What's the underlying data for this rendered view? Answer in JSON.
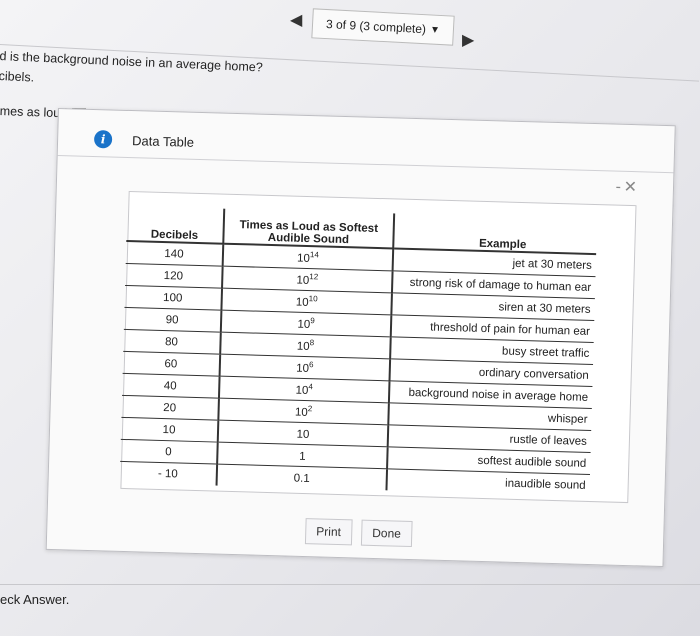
{
  "nav": {
    "prev_icon": "left-triangle-icon",
    "next_icon": "right-triangle-icon",
    "progress_label": "3 of 9 (3 complete)"
  },
  "question": {
    "line1": "d is the background noise in an average home?",
    "line2": "cibels.",
    "partial": "mes as loud as"
  },
  "check_answer": "eck Answer.",
  "modal": {
    "title": "Data Table",
    "minimize_symbol": "-",
    "close_symbol": "✕",
    "table": {
      "headers": {
        "decibels": "Decibels",
        "times_loud": "Times as Loud as Softest Audible Sound",
        "example": "Example"
      },
      "rows": [
        {
          "db": "140",
          "times_base": "10",
          "times_exp": "14",
          "example": "jet at 30 meters"
        },
        {
          "db": "120",
          "times_base": "10",
          "times_exp": "12",
          "example": "strong risk of damage to human ear"
        },
        {
          "db": "100",
          "times_base": "10",
          "times_exp": "10",
          "example": "siren at 30 meters"
        },
        {
          "db": "90",
          "times_base": "10",
          "times_exp": "9",
          "example": "threshold of pain for human ear"
        },
        {
          "db": "80",
          "times_base": "10",
          "times_exp": "8",
          "example": "busy street traffic"
        },
        {
          "db": "60",
          "times_base": "10",
          "times_exp": "6",
          "example": "ordinary conversation"
        },
        {
          "db": "40",
          "times_base": "10",
          "times_exp": "4",
          "example": "background noise in average home"
        },
        {
          "db": "20",
          "times_base": "10",
          "times_exp": "2",
          "example": "whisper"
        },
        {
          "db": "10",
          "times_base": "10",
          "times_exp": "",
          "example": "rustle of leaves"
        },
        {
          "db": "0",
          "times_base": "1",
          "times_exp": "",
          "example": "softest audible sound"
        },
        {
          "db": "- 10",
          "times_base": "0.1",
          "times_exp": "",
          "example": "inaudible sound"
        }
      ]
    },
    "buttons": {
      "print": "Print",
      "done": "Done"
    }
  }
}
